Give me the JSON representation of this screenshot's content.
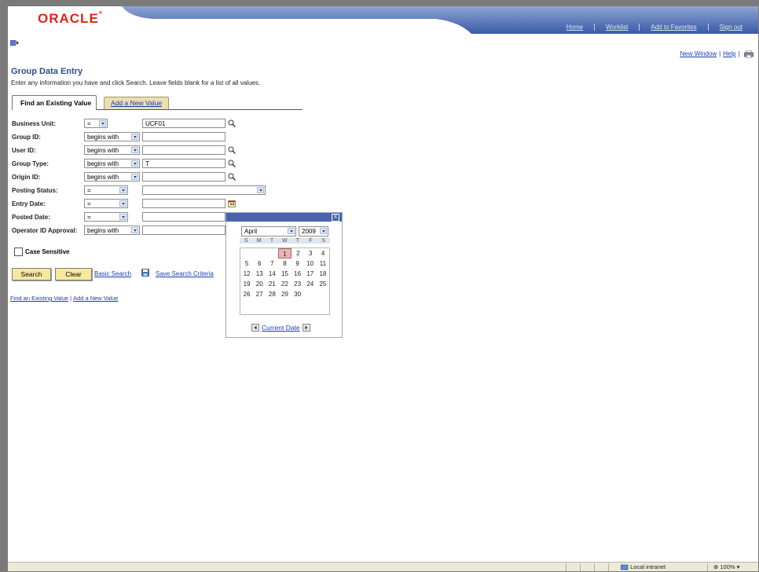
{
  "header": {
    "logo": "ORACLE",
    "nav": [
      "Home",
      "Worklist",
      "Add to Favorites",
      "Sign out"
    ]
  },
  "toplinks": {
    "new_window": "New Window",
    "help": "Help"
  },
  "page": {
    "title": "Group Data Entry",
    "instructions": "Enter any information you have and click Search. Leave fields blank for a list of all values."
  },
  "tabs": {
    "find": "Find an Existing Value",
    "add": "Add a New Value"
  },
  "fields": [
    {
      "label": "Business Unit:",
      "operator": "=",
      "value": "UCF01"
    },
    {
      "label": "Group ID:",
      "operator": "begins with",
      "value": ""
    },
    {
      "label": "User ID:",
      "operator": "begins with",
      "value": ""
    },
    {
      "label": "Group Type:",
      "operator": "begins with",
      "value": "T"
    },
    {
      "label": "Origin ID:",
      "operator": "begins with",
      "value": ""
    },
    {
      "label": "Posting Status:",
      "operator": "=",
      "value": ""
    },
    {
      "label": "Entry Date:",
      "operator": "=",
      "value": ""
    },
    {
      "label": "Posted Date:",
      "operator": "=",
      "value": ""
    },
    {
      "label": "Operator ID Approval:",
      "operator": "begins with",
      "value": ""
    }
  ],
  "case_sensitive": "Case Sensitive",
  "buttons": {
    "search": "Search",
    "clear": "Clear"
  },
  "links": {
    "basic_search": "Basic Search",
    "save_criteria": "Save Search Criteria"
  },
  "bottom_links": {
    "find": "Find an Existing Value",
    "add": "Add a New Value"
  },
  "calendar": {
    "month": "April",
    "year": "2009",
    "days_of_week": [
      "S",
      "M",
      "T",
      "W",
      "T",
      "F",
      "S"
    ],
    "weeks": [
      [
        "",
        "",
        "",
        "1",
        "2",
        "3",
        "4"
      ],
      [
        "5",
        "6",
        "7",
        "8",
        "9",
        "10",
        "11"
      ],
      [
        "12",
        "13",
        "14",
        "15",
        "16",
        "17",
        "18"
      ],
      [
        "19",
        "20",
        "21",
        "22",
        "23",
        "24",
        "25"
      ],
      [
        "26",
        "27",
        "28",
        "29",
        "30",
        "",
        ""
      ]
    ],
    "today": "1",
    "current_date": "Current Date",
    "close": "X"
  },
  "statusbar": {
    "zone": "Local intranet",
    "zoom": "100%"
  },
  "colors": {
    "brand_red": "#e2231a",
    "nav_blue": "#3a5aa7",
    "button_yellow": "#f7e79f",
    "link_blue": "#1a3cb5"
  }
}
